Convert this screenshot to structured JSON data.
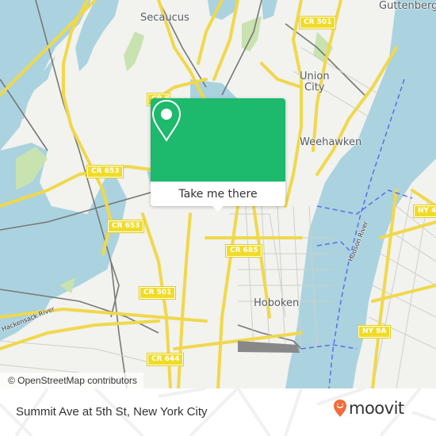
{
  "map": {
    "places": {
      "secaucus": "Secaucus",
      "guttenberg": "Guttenberg",
      "union_city_line1": "Union",
      "union_city_line2": "City",
      "weehawken": "Weehawken",
      "hoboken": "Hoboken"
    },
    "road_shields": {
      "cr501_top": "CR 501",
      "cr653_a": "CR 653",
      "cr653_b": "CR 653",
      "cr501_bottom": "CR 501",
      "cr685": "CR 685",
      "cr644": "CR 644",
      "ny9a": "NY 9A",
      "ny4": "NY 4",
      "partial": "CR 5"
    },
    "rivers": {
      "hackensack": "Hackensack River",
      "hudson": "Hudson River"
    },
    "attribution": "© OpenStreetMap contributors",
    "colors": {
      "water": "#aad3df",
      "land": "#f2f2ee",
      "road_major": "#f6e35c",
      "green": "#c8e3b0",
      "ferry": "#5b6cf0",
      "rail": "#777777"
    }
  },
  "popup": {
    "icon": "location-pin-icon",
    "button_label": "Take me there",
    "accent_color": "#1db96c"
  },
  "footer": {
    "title": "Summit Ave at 5th St, New York City",
    "logo_text": "moovit",
    "logo_color": "#f26b3a"
  }
}
